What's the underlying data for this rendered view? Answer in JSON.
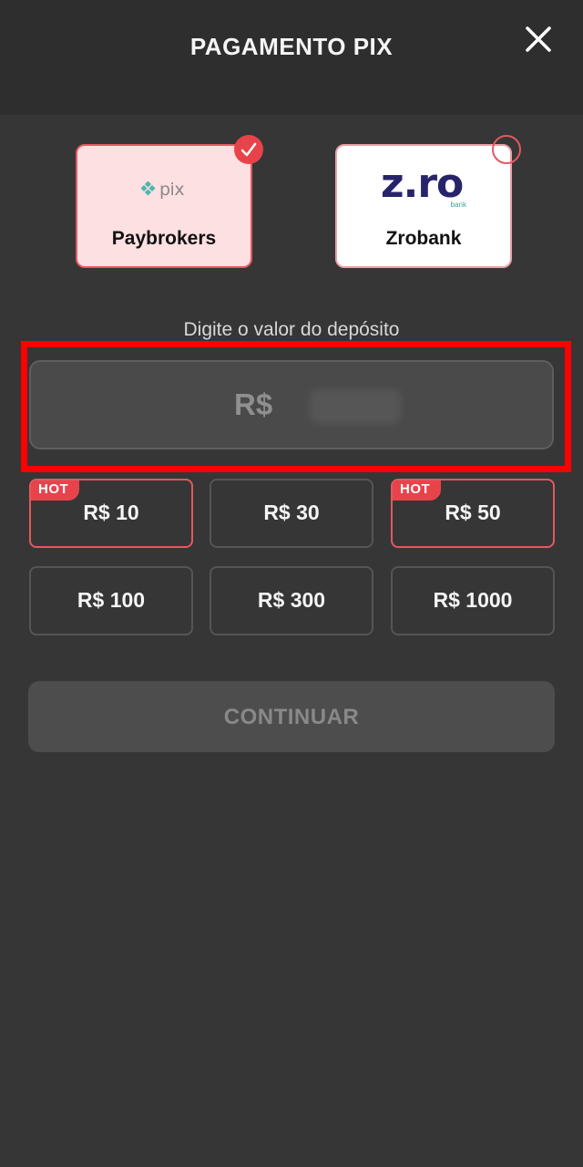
{
  "header": {
    "title": "PAGAMENTO PIX",
    "close_icon": "close-icon"
  },
  "providers": [
    {
      "name": "Paybrokers",
      "logo_text": "pix",
      "selected": true
    },
    {
      "name": "Zrobank",
      "logo_text": "z.ro",
      "logo_subtext": "bank",
      "selected": false
    }
  ],
  "deposit": {
    "label": "Digite o valor do depósito",
    "prefix": "R$"
  },
  "amounts": [
    {
      "label": "R$ 10",
      "hot": true
    },
    {
      "label": "R$ 30",
      "hot": false
    },
    {
      "label": "R$ 50",
      "hot": true
    },
    {
      "label": "R$ 100",
      "hot": false
    },
    {
      "label": "R$ 300",
      "hot": false
    },
    {
      "label": "R$ 1000",
      "hot": false
    }
  ],
  "hot_label": "HOT",
  "continue_label": "CONTINUAR",
  "colors": {
    "accent": "#e8434b",
    "background": "#363636",
    "header": "#2e2e2e",
    "highlight": "#ff0000"
  }
}
